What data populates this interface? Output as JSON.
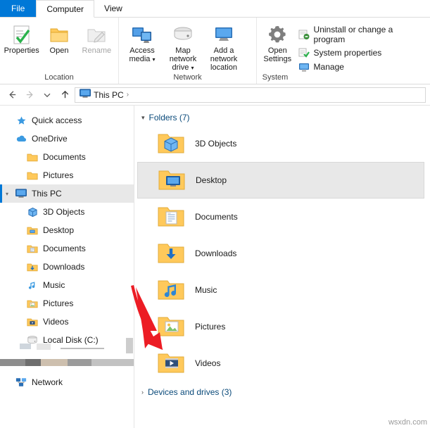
{
  "window": {
    "tabs": [
      {
        "label": "File",
        "type": "file"
      },
      {
        "label": "Computer",
        "type": "active"
      },
      {
        "label": "View",
        "type": "normal"
      }
    ]
  },
  "ribbon": {
    "groups": [
      {
        "name": "Location",
        "label": "Location",
        "commands": [
          {
            "id": "properties",
            "label": "Properties",
            "icon": "properties-icon",
            "disabled": false
          },
          {
            "id": "open",
            "label": "Open",
            "icon": "open-folder-icon",
            "disabled": false
          },
          {
            "id": "rename",
            "label": "Rename",
            "icon": "rename-icon",
            "disabled": true
          }
        ]
      },
      {
        "name": "Network",
        "label": "Network",
        "commands": [
          {
            "id": "access-media",
            "label": "Access",
            "label2": "media",
            "icon": "access-media-icon",
            "caret": true
          },
          {
            "id": "map-network-drive",
            "label": "Map network",
            "label2": "drive",
            "icon": "map-drive-icon",
            "caret": true
          },
          {
            "id": "add-a-network-location",
            "label": "Add a network",
            "label2": "location",
            "icon": "add-network-location-icon",
            "caret": false
          }
        ]
      },
      {
        "name": "System",
        "label": "System",
        "commands": [
          {
            "id": "open-settings",
            "label": "Open",
            "label2": "Settings",
            "icon": "gear-icon"
          }
        ],
        "small_commands": [
          {
            "id": "uninstall-or-change-a-program",
            "label": "Uninstall or change a program",
            "icon": "uninstall-icon"
          },
          {
            "id": "system-properties",
            "label": "System properties",
            "icon": "system-properties-icon"
          },
          {
            "id": "manage",
            "label": "Manage",
            "icon": "manage-icon"
          }
        ]
      }
    ]
  },
  "addressbar": {
    "back_icon": "arrow-left-icon",
    "forward_icon": "arrow-right-icon",
    "recent_icon": "chevron-down-icon",
    "up_icon": "arrow-up-icon",
    "location_icon": "this-pc-icon",
    "path": "This PC",
    "separator": "›"
  },
  "navpane": {
    "items": [
      {
        "label": "Quick access",
        "icon": "pin-star-icon",
        "indent": 0,
        "chevron": "",
        "selected": false
      },
      {
        "label": "OneDrive",
        "icon": "cloud-icon",
        "indent": 0,
        "chevron": "",
        "selected": false
      },
      {
        "label": "Documents",
        "icon": "folder-yellow-icon",
        "indent": 1,
        "chevron": "",
        "selected": false
      },
      {
        "label": "Pictures",
        "icon": "folder-yellow-icon",
        "indent": 1,
        "chevron": "",
        "selected": false
      },
      {
        "label": "This PC",
        "icon": "this-pc-icon",
        "indent": 0,
        "chevron": "▾",
        "selected": true
      },
      {
        "label": "3D Objects",
        "icon": "3d-objects-icon",
        "indent": 1,
        "chevron": "",
        "selected": false
      },
      {
        "label": "Desktop",
        "icon": "desktop-icon",
        "indent": 1,
        "chevron": "",
        "selected": false
      },
      {
        "label": "Documents",
        "icon": "documents-icon",
        "indent": 1,
        "chevron": "",
        "selected": false
      },
      {
        "label": "Downloads",
        "icon": "downloads-icon",
        "indent": 1,
        "chevron": "",
        "selected": false
      },
      {
        "label": "Music",
        "icon": "music-icon",
        "indent": 1,
        "chevron": "",
        "selected": false
      },
      {
        "label": "Pictures",
        "icon": "pictures-icon",
        "indent": 1,
        "chevron": "",
        "selected": false
      },
      {
        "label": "Videos",
        "icon": "videos-icon",
        "indent": 1,
        "chevron": "",
        "selected": false
      },
      {
        "label": "Local Disk (C:)",
        "icon": "local-disk-icon",
        "indent": 1,
        "chevron": "",
        "selected": false
      },
      {
        "label": "Network",
        "icon": "network-icon",
        "indent": 0,
        "chevron": "",
        "selected": false
      }
    ]
  },
  "content": {
    "sections": [
      {
        "id": "folders",
        "label": "Folders (7)",
        "chevron": "▾",
        "expanded": true
      },
      {
        "id": "devices-and-drives",
        "label": "Devices and drives (3)",
        "chevron": "›",
        "expanded": false
      }
    ],
    "folders": [
      {
        "name": "3D Objects",
        "icon": "3d-objects-icon",
        "selected": false
      },
      {
        "name": "Desktop",
        "icon": "desktop-icon",
        "selected": true
      },
      {
        "name": "Documents",
        "icon": "documents-icon",
        "selected": false
      },
      {
        "name": "Downloads",
        "icon": "downloads-icon",
        "selected": false
      },
      {
        "name": "Music",
        "icon": "music-icon",
        "selected": false
      },
      {
        "name": "Pictures",
        "icon": "pictures-icon",
        "selected": false
      },
      {
        "name": "Videos",
        "icon": "videos-icon",
        "selected": false
      }
    ]
  },
  "annotation": {
    "arrow_color": "#ec1c24",
    "target": "Local Disk (C:)"
  },
  "watermark": "wsxdn.com",
  "colors": {
    "accent": "#0078d7",
    "selection": "#e8e8e8",
    "folder_yellow": "#ffc95b",
    "link_blue": "#0a4a7a"
  }
}
